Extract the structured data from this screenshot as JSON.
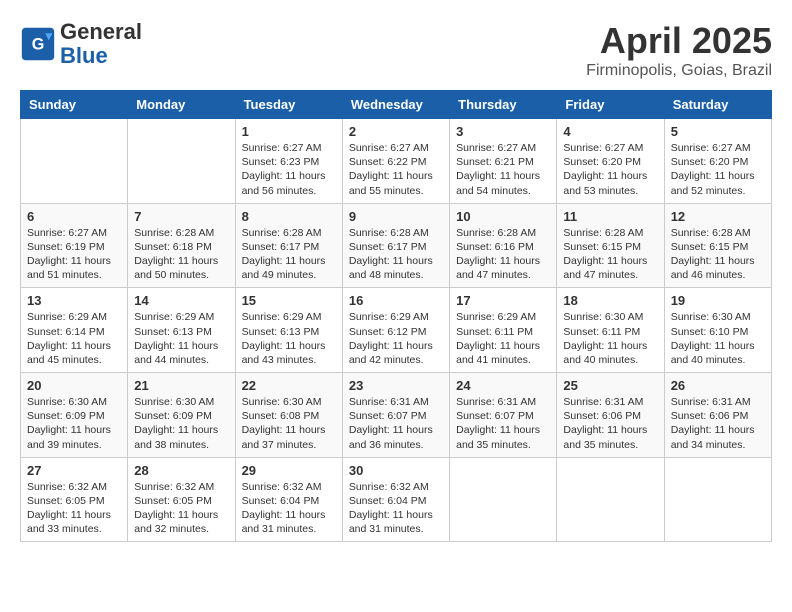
{
  "logo": {
    "general": "General",
    "blue": "Blue"
  },
  "title": {
    "month": "April 2025",
    "location": "Firminopolis, Goias, Brazil"
  },
  "headers": [
    "Sunday",
    "Monday",
    "Tuesday",
    "Wednesday",
    "Thursday",
    "Friday",
    "Saturday"
  ],
  "weeks": [
    [
      {
        "day": "",
        "info": ""
      },
      {
        "day": "",
        "info": ""
      },
      {
        "day": "1",
        "info": "Sunrise: 6:27 AM\nSunset: 6:23 PM\nDaylight: 11 hours and 56 minutes."
      },
      {
        "day": "2",
        "info": "Sunrise: 6:27 AM\nSunset: 6:22 PM\nDaylight: 11 hours and 55 minutes."
      },
      {
        "day": "3",
        "info": "Sunrise: 6:27 AM\nSunset: 6:21 PM\nDaylight: 11 hours and 54 minutes."
      },
      {
        "day": "4",
        "info": "Sunrise: 6:27 AM\nSunset: 6:20 PM\nDaylight: 11 hours and 53 minutes."
      },
      {
        "day": "5",
        "info": "Sunrise: 6:27 AM\nSunset: 6:20 PM\nDaylight: 11 hours and 52 minutes."
      }
    ],
    [
      {
        "day": "6",
        "info": "Sunrise: 6:27 AM\nSunset: 6:19 PM\nDaylight: 11 hours and 51 minutes."
      },
      {
        "day": "7",
        "info": "Sunrise: 6:28 AM\nSunset: 6:18 PM\nDaylight: 11 hours and 50 minutes."
      },
      {
        "day": "8",
        "info": "Sunrise: 6:28 AM\nSunset: 6:17 PM\nDaylight: 11 hours and 49 minutes."
      },
      {
        "day": "9",
        "info": "Sunrise: 6:28 AM\nSunset: 6:17 PM\nDaylight: 11 hours and 48 minutes."
      },
      {
        "day": "10",
        "info": "Sunrise: 6:28 AM\nSunset: 6:16 PM\nDaylight: 11 hours and 47 minutes."
      },
      {
        "day": "11",
        "info": "Sunrise: 6:28 AM\nSunset: 6:15 PM\nDaylight: 11 hours and 47 minutes."
      },
      {
        "day": "12",
        "info": "Sunrise: 6:28 AM\nSunset: 6:15 PM\nDaylight: 11 hours and 46 minutes."
      }
    ],
    [
      {
        "day": "13",
        "info": "Sunrise: 6:29 AM\nSunset: 6:14 PM\nDaylight: 11 hours and 45 minutes."
      },
      {
        "day": "14",
        "info": "Sunrise: 6:29 AM\nSunset: 6:13 PM\nDaylight: 11 hours and 44 minutes."
      },
      {
        "day": "15",
        "info": "Sunrise: 6:29 AM\nSunset: 6:13 PM\nDaylight: 11 hours and 43 minutes."
      },
      {
        "day": "16",
        "info": "Sunrise: 6:29 AM\nSunset: 6:12 PM\nDaylight: 11 hours and 42 minutes."
      },
      {
        "day": "17",
        "info": "Sunrise: 6:29 AM\nSunset: 6:11 PM\nDaylight: 11 hours and 41 minutes."
      },
      {
        "day": "18",
        "info": "Sunrise: 6:30 AM\nSunset: 6:11 PM\nDaylight: 11 hours and 40 minutes."
      },
      {
        "day": "19",
        "info": "Sunrise: 6:30 AM\nSunset: 6:10 PM\nDaylight: 11 hours and 40 minutes."
      }
    ],
    [
      {
        "day": "20",
        "info": "Sunrise: 6:30 AM\nSunset: 6:09 PM\nDaylight: 11 hours and 39 minutes."
      },
      {
        "day": "21",
        "info": "Sunrise: 6:30 AM\nSunset: 6:09 PM\nDaylight: 11 hours and 38 minutes."
      },
      {
        "day": "22",
        "info": "Sunrise: 6:30 AM\nSunset: 6:08 PM\nDaylight: 11 hours and 37 minutes."
      },
      {
        "day": "23",
        "info": "Sunrise: 6:31 AM\nSunset: 6:07 PM\nDaylight: 11 hours and 36 minutes."
      },
      {
        "day": "24",
        "info": "Sunrise: 6:31 AM\nSunset: 6:07 PM\nDaylight: 11 hours and 35 minutes."
      },
      {
        "day": "25",
        "info": "Sunrise: 6:31 AM\nSunset: 6:06 PM\nDaylight: 11 hours and 35 minutes."
      },
      {
        "day": "26",
        "info": "Sunrise: 6:31 AM\nSunset: 6:06 PM\nDaylight: 11 hours and 34 minutes."
      }
    ],
    [
      {
        "day": "27",
        "info": "Sunrise: 6:32 AM\nSunset: 6:05 PM\nDaylight: 11 hours and 33 minutes."
      },
      {
        "day": "28",
        "info": "Sunrise: 6:32 AM\nSunset: 6:05 PM\nDaylight: 11 hours and 32 minutes."
      },
      {
        "day": "29",
        "info": "Sunrise: 6:32 AM\nSunset: 6:04 PM\nDaylight: 11 hours and 31 minutes."
      },
      {
        "day": "30",
        "info": "Sunrise: 6:32 AM\nSunset: 6:04 PM\nDaylight: 11 hours and 31 minutes."
      },
      {
        "day": "",
        "info": ""
      },
      {
        "day": "",
        "info": ""
      },
      {
        "day": "",
        "info": ""
      }
    ]
  ]
}
